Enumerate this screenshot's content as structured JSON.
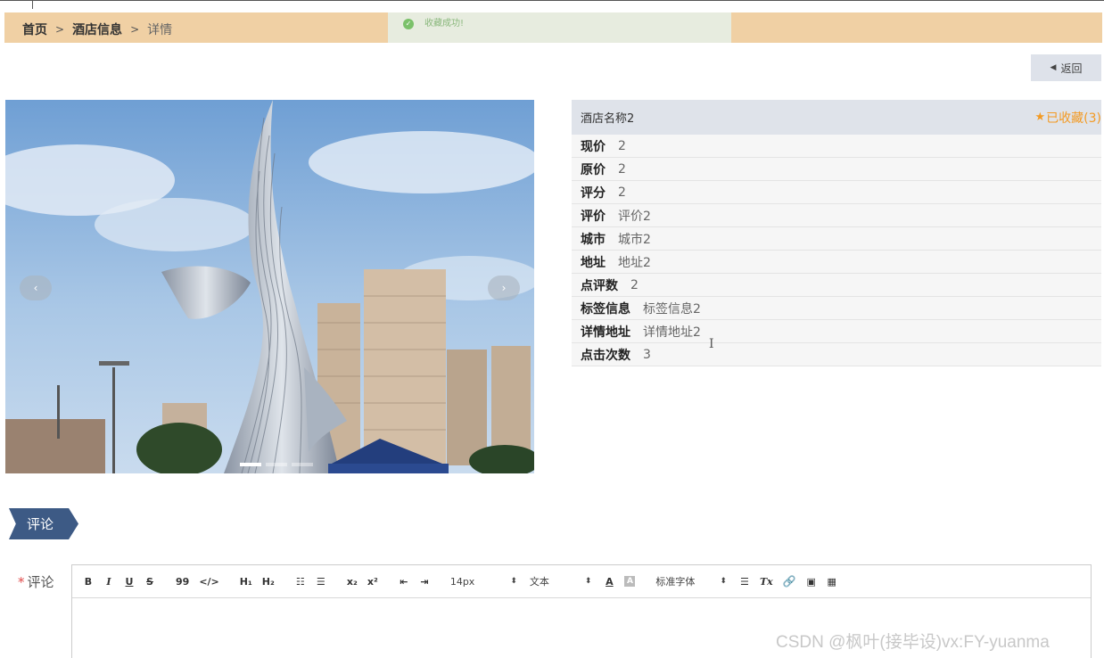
{
  "breadcrumb": {
    "home": "首页",
    "separator": ">",
    "hotel_info": "酒店信息",
    "current": "详情"
  },
  "toast": {
    "message": "收藏成功!",
    "icon": "check-circle-icon"
  },
  "back_button": {
    "label": "返回",
    "icon": "triangle-left-icon"
  },
  "carousel": {
    "prev": "‹",
    "next": "›",
    "slides": 3,
    "active_slide": 1
  },
  "hotel": {
    "name": "酒店名称2",
    "favorite_star": "★",
    "favorite_text": "已收藏(3)",
    "fields": [
      {
        "key": "现价",
        "value": "2"
      },
      {
        "key": "原价",
        "value": "2"
      },
      {
        "key": "评分",
        "value": "2"
      },
      {
        "key": "评价",
        "value": "评价2"
      },
      {
        "key": "城市",
        "value": "城市2"
      },
      {
        "key": "地址",
        "value": "地址2"
      },
      {
        "key": "点评数",
        "value": "2"
      },
      {
        "key": "标签信息",
        "value": "标签信息2"
      },
      {
        "key": "详情地址",
        "value": "详情地址2"
      },
      {
        "key": "点击次数",
        "value": "3"
      }
    ]
  },
  "comment_section": {
    "tag": "评论",
    "field_label": "评论",
    "required_mark": "*"
  },
  "editor_toolbar": {
    "bold": "B",
    "italic": "I",
    "underline": "U",
    "strike": "S",
    "quote": "99",
    "code": "</>",
    "h1": "H₁",
    "h2": "H₂",
    "ordered_list": "☷",
    "bullet_list": "☰",
    "subscript": "x₂",
    "superscript": "x²",
    "outdent": "⇤",
    "indent": "⇥",
    "font_size": "14px",
    "text_style": "文本",
    "color": "A",
    "background": "A",
    "font_family": "标准字体",
    "align": "☰",
    "clear_format": "Tx",
    "link": "🔗",
    "image": "▣",
    "video": "▦",
    "select_arrow": "⬍"
  },
  "watermark": "CSDN @枫叶(接毕设)vx:FY-yuanma",
  "colors": {
    "breadcrumb_bg": "#f0d0a4",
    "accent_navy": "#3d5a85",
    "favorite_orange": "#f39a23",
    "toast_bg": "#e7ecdf"
  }
}
